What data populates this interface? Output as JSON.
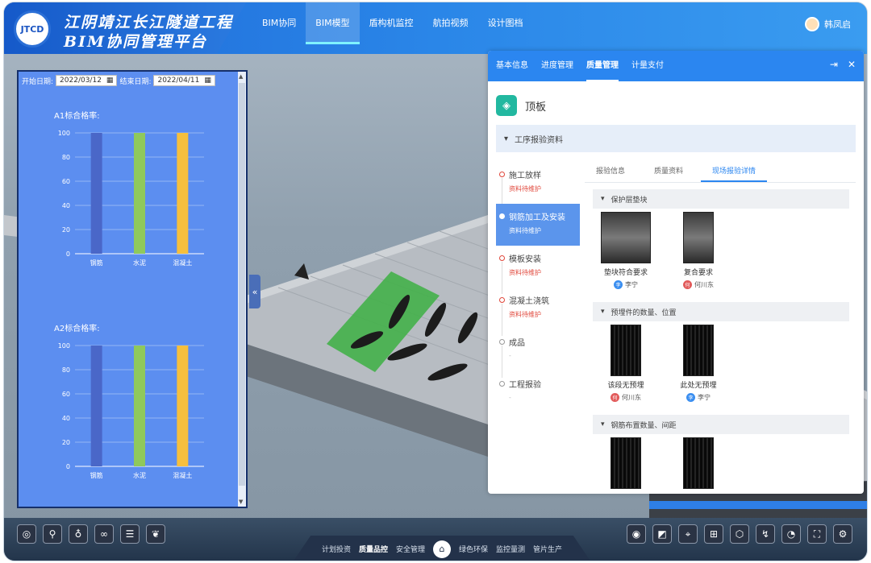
{
  "header": {
    "logo_text": "JTCD",
    "title_line1": "江阴靖江长江隧道工程",
    "title_line2": "BIM协同管理平台",
    "nav": [
      "BIM协同",
      "BIM模型",
      "盾构机监控",
      "航拍视频",
      "设计图档"
    ],
    "active_nav": "BIM模型",
    "user": "韩凤启"
  },
  "left_panel": {
    "start_label": "开始日期:",
    "start_date": "2022/03/12",
    "end_label": "结束日期:",
    "end_date": "2022/04/11",
    "charts": [
      {
        "title": "A1标合格率:",
        "categories": [
          "钢筋",
          "水泥",
          "混凝土"
        ],
        "values": [
          100,
          100,
          100
        ],
        "ylim": [
          0,
          100
        ],
        "ticks": [
          0,
          20,
          40,
          60,
          80,
          100
        ],
        "colors": [
          "#4a67c8",
          "#8fc95c",
          "#f6bf3d"
        ]
      },
      {
        "title": "A2标合格率:",
        "categories": [
          "钢筋",
          "水泥",
          "混凝土"
        ],
        "values": [
          100,
          100,
          100
        ],
        "ylim": [
          0,
          100
        ],
        "ticks": [
          0,
          20,
          40,
          60,
          80,
          100
        ],
        "colors": [
          "#4a67c8",
          "#8fc95c",
          "#f6bf3d"
        ]
      }
    ]
  },
  "right_panel": {
    "tabs": [
      "基本信息",
      "进度管理",
      "质量管理",
      "计量支付"
    ],
    "active_tab": "质量管理",
    "object_name": "顶板",
    "section": "工序报验资料",
    "steps": [
      {
        "name": "施工放样",
        "status": "资料待维护"
      },
      {
        "name": "钢筋加工及安装",
        "status": "资料待维护",
        "active": true
      },
      {
        "name": "模板安装",
        "status": "资料待维护"
      },
      {
        "name": "混凝土浇筑",
        "status": "资料待维护"
      },
      {
        "name": "成品",
        "status": "-"
      },
      {
        "name": "工程报验",
        "status": "-"
      }
    ],
    "subtabs": [
      "报验信息",
      "质量资料",
      "现场报验详情"
    ],
    "active_subtab": "现场报验详情",
    "groups": [
      {
        "title": "保护层垫块",
        "photos": [
          {
            "caption": "垫块符合要求",
            "user": "李宁",
            "color": "blue"
          },
          {
            "caption": "复合要求",
            "user": "何川东",
            "color": "red"
          }
        ]
      },
      {
        "title": "预埋件的数量、位置",
        "photos": [
          {
            "caption": "该段无预埋",
            "user": "何川东",
            "color": "red"
          },
          {
            "caption": "此处无预埋",
            "user": "李宁",
            "color": "blue"
          }
        ]
      },
      {
        "title": "钢筋布置数量、间距",
        "photos": [
          {
            "caption": "",
            "user": "",
            "color": "blue"
          },
          {
            "caption": "",
            "user": "",
            "color": "blue"
          }
        ]
      }
    ]
  },
  "bottom_nav": [
    "计划投资",
    "质量品控",
    "安全管理",
    "绿色环保",
    "监控量测",
    "管片生产"
  ],
  "active_bottom": "质量品控"
}
